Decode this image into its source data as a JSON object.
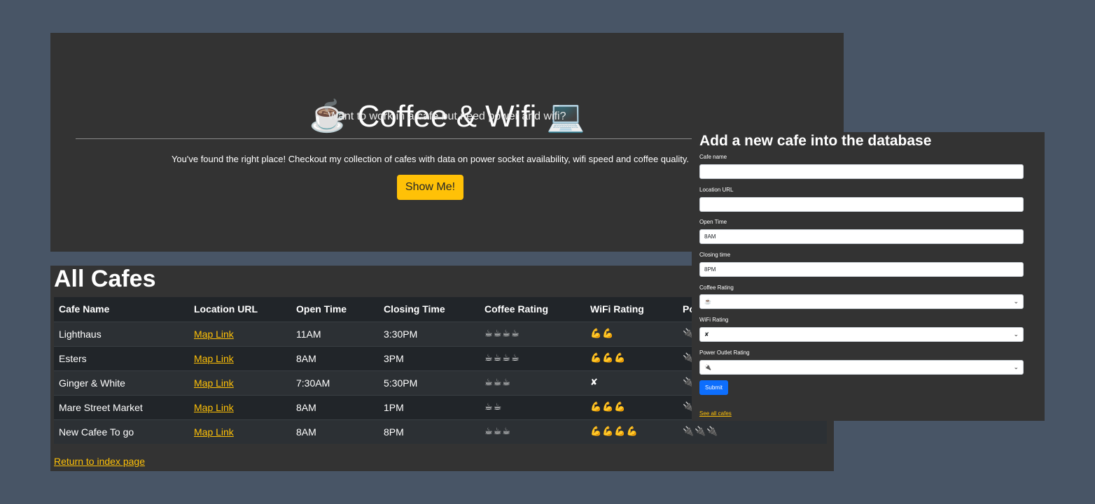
{
  "hero": {
    "icon_left": "☕",
    "title": "Coffee & Wifi",
    "icon_right": "💻",
    "subtitle": "Want to work in a cafe but need power and wifi?",
    "lead": "You've found the right place! Checkout my collection of cafes with data on power socket availability, wifi speed and coffee quality.",
    "button_label": "Show Me!"
  },
  "cafes": {
    "title": "All Cafes",
    "headers": [
      "Cafe Name",
      "Location URL",
      "Open Time",
      "Closing Time",
      "Coffee Rating",
      "WiFi Rating",
      "Po"
    ],
    "rows": [
      [
        "Lighthaus",
        "Map Link",
        "11AM",
        "3:30PM",
        "☕☕☕☕",
        "💪💪",
        "🔌"
      ],
      [
        "Esters",
        "Map Link",
        "8AM",
        "3PM",
        "☕☕☕☕",
        "💪💪💪",
        "🔌"
      ],
      [
        "Ginger & White",
        "Map Link",
        "7:30AM",
        "5:30PM",
        "☕☕☕",
        "✘",
        "🔌"
      ],
      [
        "Mare Street Market",
        "Map Link",
        "8AM",
        "1PM",
        "☕☕",
        "💪💪💪",
        "🔌"
      ],
      [
        "New Cafee To go",
        "Map Link",
        "8AM",
        "8PM",
        "☕☕☕",
        "💪💪💪💪",
        "🔌🔌🔌"
      ]
    ],
    "return_link": "Return to index page"
  },
  "form": {
    "title": "Add a new cafe into the database",
    "cafe_name_label": "Cafe name",
    "cafe_name_value": "",
    "location_label": "Location URL",
    "location_value": "",
    "open_label": "Open Time",
    "open_value": "8AM",
    "close_label": "Closing time",
    "close_value": "8PM",
    "coffee_label": "Coffee Rating",
    "coffee_value": "☕",
    "wifi_label": "WiFi Rating",
    "wifi_value": "✘",
    "power_label": "Power Outlet Rating",
    "power_value": "🔌",
    "submit_label": "Submit",
    "see_all_link": "See all cafes"
  },
  "colors": {
    "background": "#485566",
    "panel": "#333333",
    "accent": "#ffc107",
    "primary": "#0d6efd"
  }
}
